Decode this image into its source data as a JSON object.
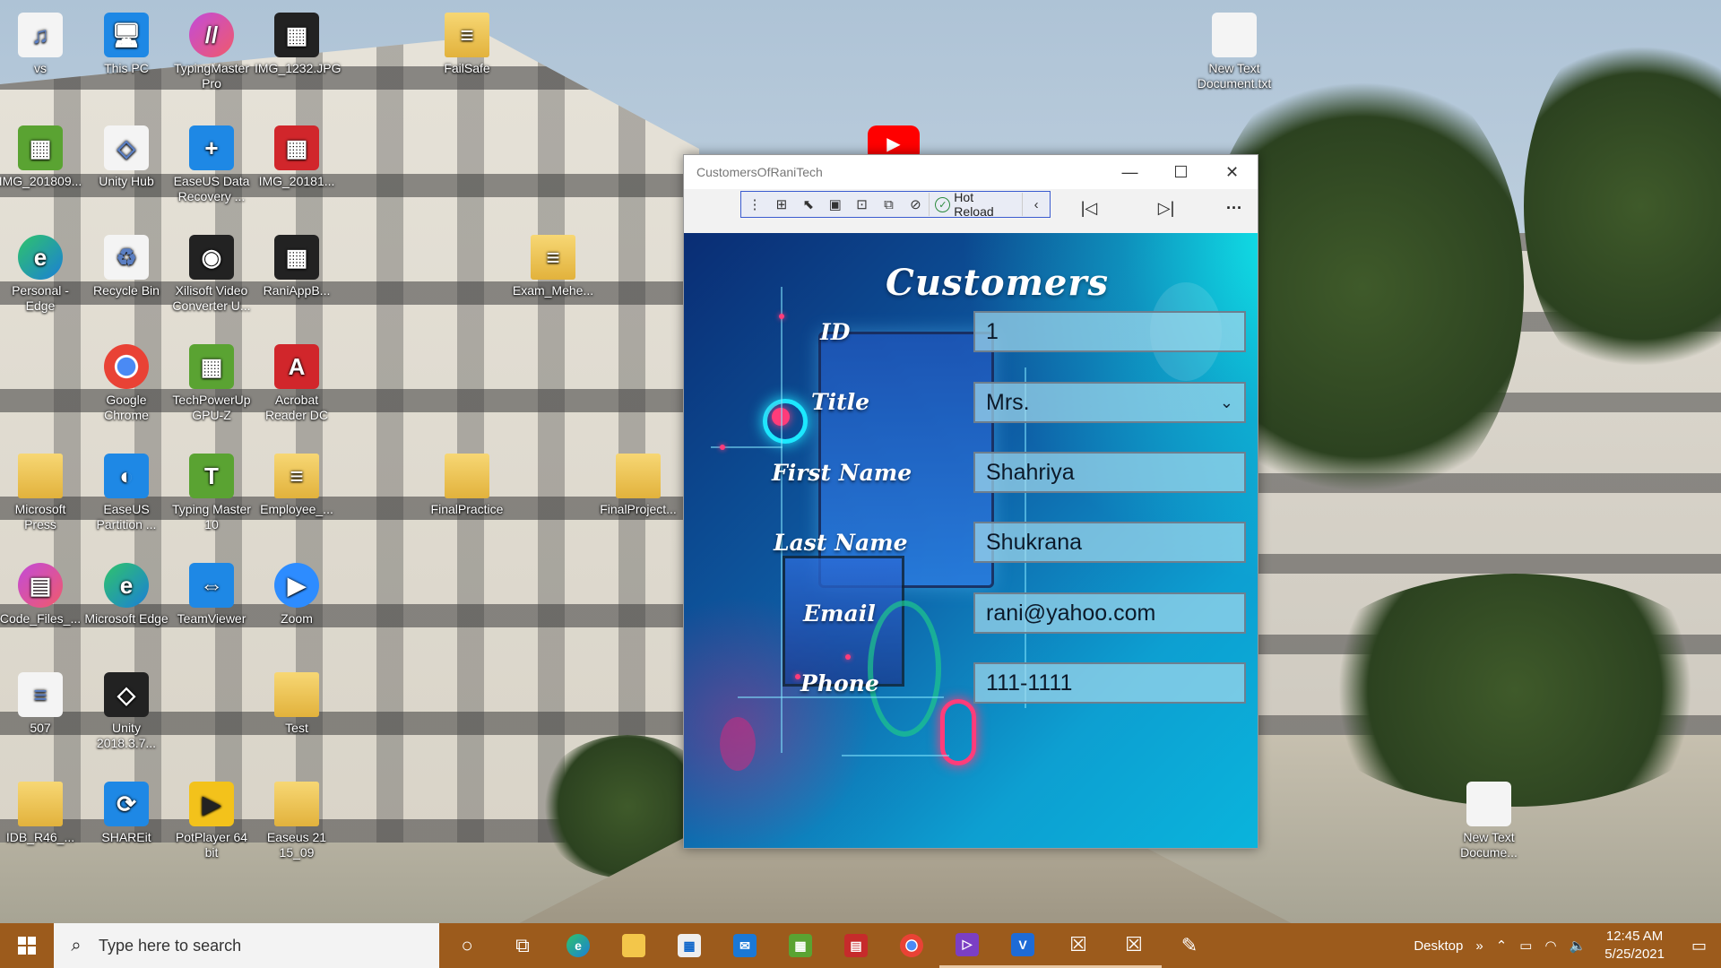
{
  "desktop": {
    "icons": [
      {
        "label": "vs",
        "glyph": "♫",
        "kind": "g-file"
      },
      {
        "label": "This PC",
        "glyph": "🖥",
        "kind": "g-blue"
      },
      {
        "label": "TypingMaster Pro",
        "glyph": "//",
        "kind": "g-purple"
      },
      {
        "label": "IMG_1232.JPG",
        "glyph": "▦",
        "kind": "g-dark"
      },
      {
        "label": "FailSafe",
        "glyph": "≡",
        "kind": "g-folder"
      },
      {
        "label": "New Text Document.txt",
        "glyph": "",
        "kind": "g-file"
      },
      {
        "label": "IMG_201809...",
        "glyph": "▦",
        "kind": "g-green"
      },
      {
        "label": "Unity Hub",
        "glyph": "◇",
        "kind": "g-file"
      },
      {
        "label": "EaseUS Data Recovery ...",
        "glyph": "+",
        "kind": "g-blue"
      },
      {
        "label": "IMG_20181...",
        "glyph": "▦",
        "kind": "g-red"
      },
      {
        "label": "Personal - Edge",
        "glyph": "e",
        "kind": "g-edge"
      },
      {
        "label": "Recycle Bin",
        "glyph": "♻",
        "kind": "g-file"
      },
      {
        "label": "Xilisoft Video Converter U...",
        "glyph": "◉",
        "kind": "g-dark"
      },
      {
        "label": "RaniAppB...",
        "glyph": "▦",
        "kind": "g-dark"
      },
      {
        "label": "Exam_Mehe...",
        "glyph": "≡",
        "kind": "g-folder"
      },
      {
        "label": "Google Chrome",
        "glyph": "",
        "kind": "g-chrome"
      },
      {
        "label": "TechPowerUp GPU-Z",
        "glyph": "▦",
        "kind": "g-green"
      },
      {
        "label": "Acrobat Reader DC",
        "glyph": "A",
        "kind": "g-red"
      },
      {
        "label": "Microsoft Press",
        "glyph": "",
        "kind": "g-folder"
      },
      {
        "label": "EaseUS Partition ...",
        "glyph": "◐",
        "kind": "g-blue"
      },
      {
        "label": "Typing Master 10",
        "glyph": "T",
        "kind": "g-green"
      },
      {
        "label": "Employee_...",
        "glyph": "≡",
        "kind": "g-folder"
      },
      {
        "label": "FinalPractice",
        "glyph": "",
        "kind": "g-folder"
      },
      {
        "label": "FinalProject...",
        "glyph": "",
        "kind": "g-folder"
      },
      {
        "label": "Code_Files_...",
        "glyph": "▤",
        "kind": "g-purple"
      },
      {
        "label": "Microsoft Edge",
        "glyph": "e",
        "kind": "g-edge"
      },
      {
        "label": "TeamViewer",
        "glyph": "⇔",
        "kind": "g-blue"
      },
      {
        "label": "Zoom",
        "glyph": "▶",
        "kind": "g-zoom"
      },
      {
        "label": "507",
        "glyph": "≡",
        "kind": "g-file"
      },
      {
        "label": "Unity 2018.3.7...",
        "glyph": "◇",
        "kind": "g-dark"
      },
      {
        "label": "Test",
        "glyph": "",
        "kind": "g-folder"
      },
      {
        "label": "IDB_R46_...",
        "glyph": "",
        "kind": "g-folder"
      },
      {
        "label": "SHAREit",
        "glyph": "⟳",
        "kind": "g-blue"
      },
      {
        "label": "PotPlayer 64 bit",
        "glyph": "▶",
        "kind": "g-yellow"
      },
      {
        "label": "Easeus 21 15_09",
        "glyph": "",
        "kind": "g-folder"
      },
      {
        "label": "New Text Docume...",
        "glyph": "",
        "kind": "g-file"
      }
    ]
  },
  "window": {
    "title": "CustomersOfRaniTech",
    "minimize": "—",
    "maximize": "☐",
    "close": "✕",
    "toolbar": {
      "hot_reload_label": "Hot Reload",
      "first_glyph": "|◁",
      "last_glyph": "▷|",
      "more_glyph": "···"
    },
    "form": {
      "heading": "Customers",
      "fields": {
        "id": {
          "label": "ID",
          "value": "1"
        },
        "title": {
          "label": "Title",
          "value": "Mrs."
        },
        "first_name": {
          "label": "First Name",
          "value": "Shahriya"
        },
        "last_name": {
          "label": "Last Name",
          "value": "Shukrana"
        },
        "email": {
          "label": "Email",
          "value": "rani@yahoo.com"
        },
        "phone": {
          "label": "Phone",
          "value": "111-1111"
        }
      }
    }
  },
  "taskbar": {
    "search_placeholder": "Type here to search",
    "desktop_label": "Desktop",
    "time": "12:45 AM",
    "date": "5/25/2021"
  },
  "colors": {
    "taskbar": "#9c5b1c",
    "accent": "#3a5bd0"
  }
}
